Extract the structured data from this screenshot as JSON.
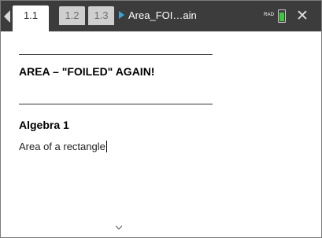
{
  "tabs": [
    {
      "label": "1.1",
      "active": true
    },
    {
      "label": "1.2",
      "active": false
    },
    {
      "label": "1.3",
      "active": false
    }
  ],
  "document_title": "Area_FOI…ain",
  "status": {
    "angle_mode": "RAD",
    "battery_level": 0.85,
    "battery_color": "#3cc83c"
  },
  "icons": {
    "back": "left-triangle-icon",
    "document": "play-arrow-icon",
    "close": "close-icon",
    "scroll": "chevron-down-icon"
  },
  "content": {
    "heading": "AREA – \"FOILED\" AGAIN!",
    "subheading": "Algebra 1",
    "body_text": "Area of a rectangle"
  }
}
